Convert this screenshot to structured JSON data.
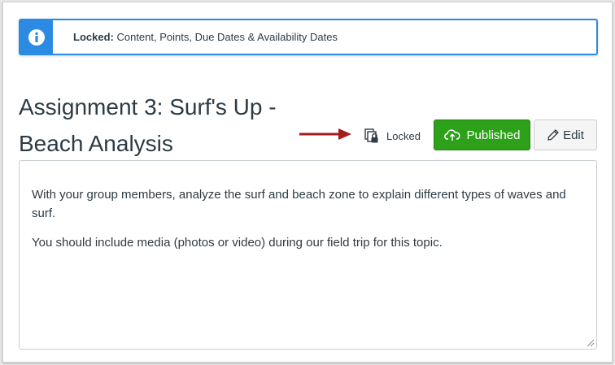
{
  "alert": {
    "icon": "info-icon",
    "strong_label": "Locked:",
    "message": "Content, Points, Due Dates & Availability Dates",
    "accent_color": "#2b8be2"
  },
  "assignment": {
    "title_line1": "Assignment 3: Surf's Up -",
    "title_line2": "Beach Analysis"
  },
  "annotation": {
    "arrow_color": "#a51c1c"
  },
  "lock_status": {
    "icon": "lock-icon",
    "label": "Locked"
  },
  "actions": {
    "published_label": "Published",
    "published_icon": "cloud-upload-icon",
    "published_color": "#2ea11a",
    "edit_label": "Edit",
    "edit_icon": "pencil-icon"
  },
  "description": {
    "paragraphs": [
      "With your group members, analyze the surf and beach zone to explain different types of waves and surf.",
      "You should include media (photos or video) during our field trip for this topic."
    ]
  }
}
